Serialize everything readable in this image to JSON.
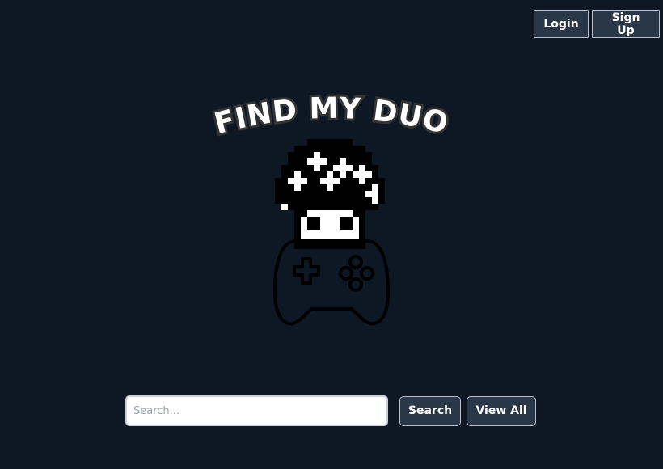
{
  "header": {
    "login_label": "Login",
    "signup_label": "Sign Up"
  },
  "logo": {
    "title": "FIND MY DUO"
  },
  "search": {
    "placeholder": "Search...",
    "value": "",
    "search_label": "Search",
    "view_all_label": "View All"
  },
  "colors": {
    "background": "#0e1824",
    "button_bg": "#2a3746",
    "button_border": "#b9c2cc"
  },
  "icons": [
    "mushroom-icon",
    "game-controller-icon"
  ]
}
